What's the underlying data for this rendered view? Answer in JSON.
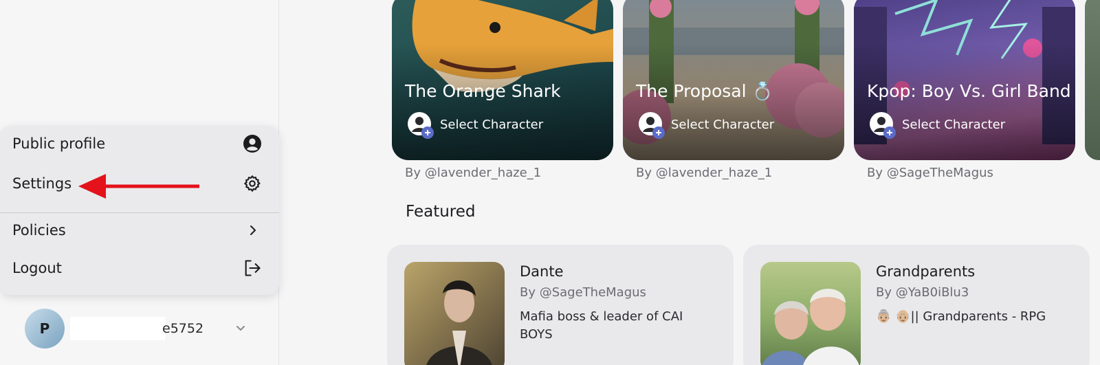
{
  "menu": {
    "items": [
      {
        "label": "Public profile",
        "icon": "user-circle-icon"
      },
      {
        "label": "Settings",
        "icon": "gear-icon"
      },
      {
        "label": "Policies",
        "icon": "chevron-right-icon"
      },
      {
        "label": "Logout",
        "icon": "logout-icon"
      }
    ]
  },
  "annotation": {
    "arrow_color": "#e3121b"
  },
  "account": {
    "avatar_initial": "P",
    "username_visible": "e5752"
  },
  "characters": [
    {
      "title": "The Orange Shark",
      "select_label": "Select Character",
      "author": "By @lavender_haze_1"
    },
    {
      "title": "The Proposal 💍",
      "select_label": "Select Character",
      "author": "By @lavender_haze_1"
    },
    {
      "title": "Kpop: Boy Vs. Girl Band",
      "select_label": "Select Character",
      "author": "By @SageTheMagus"
    }
  ],
  "featured": {
    "heading": "Featured",
    "items": [
      {
        "name": "Dante",
        "author": "By @SageTheMagus",
        "description": "Mafia boss & leader of CAI BOYS"
      },
      {
        "name": "Grandparents",
        "author": "By @YaB0iBlu3",
        "description": "👵🏼 👴🏼|| Grandparents - RPG"
      }
    ]
  },
  "colors": {
    "accent_badge": "#5b6bc8",
    "sidebar_bg": "#f6f6f7",
    "menu_bg": "#eaeaec"
  }
}
